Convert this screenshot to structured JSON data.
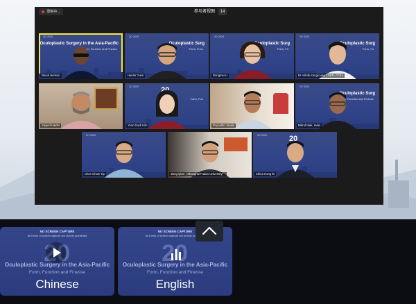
{
  "meeting": {
    "recording_label": "录制中...",
    "title": "参与者视图",
    "participant_count": "14"
  },
  "slide": {
    "header": "2O 2020",
    "title": "Oculoplastic Surgery in the Asia-Pacific",
    "subtitle": "Form, Function and Finesse"
  },
  "tiles": [
    {
      "name": "Raoul Henson",
      "kind": "slide-person",
      "active": true,
      "title": "Oculoplastic Surgery in the Asia-Pacific",
      "subtitle": "Form, Function and Finesse"
    },
    {
      "name": "Hunter Yuen",
      "kind": "slide-person",
      "title": "Oculoplastic Surg",
      "subtitle": "Form, Func"
    },
    {
      "name": "Dongmei Li",
      "kind": "slide-person",
      "title": "Oculoplastic Surg",
      "subtitle": "Form, Fu"
    },
    {
      "name": "Dr Ashok Kang-Lung CHEN, CCKL",
      "kind": "slide-person",
      "title": "Oculoplastic Surg",
      "subtitle": "Form, Fu"
    },
    {
      "name": "Saiyed Haider",
      "kind": "home-person"
    },
    {
      "name": "Yoon Duck Kim",
      "kind": "slide-person",
      "title": "20",
      "subtitle": "Form, Fun"
    },
    {
      "name": "Rcynaldo Javate",
      "kind": "home-person"
    },
    {
      "name": "Milind Naik, India",
      "kind": "slide-person",
      "title": "Oculoplastic Surg",
      "subtitle": "Form, Function and Finesse"
    },
    {
      "name": "Chen Chow Yip",
      "kind": "slide-person",
      "title": "",
      "subtitle": ""
    },
    {
      "name": "Jiong Qian（Shanghai Fudan University）",
      "kind": "home-person"
    },
    {
      "name": "China Hong lin",
      "kind": "slide-person",
      "title": "20",
      "subtitle": ""
    }
  ],
  "cards": [
    {
      "warning_title": "NO SCREEN CAPTURE",
      "warning_text": "All forms of screen capture are strictly prohibited",
      "title": "Oculoplastic Surgery in the Asia-Pacific",
      "subtitle": "Form, Function and Finesse",
      "language": "Chinese",
      "control_icon": "play-icon"
    },
    {
      "warning_title": "NO SCREEN CAPTURE",
      "warning_text": "All forms of screen capture are strictly prohibited",
      "title": "Oculoplastic Surgery in the Asia-Pacific",
      "subtitle": "Form, Function and Finesse",
      "language": "English",
      "control_icon": "bar-chart-icon"
    }
  ],
  "colors": {
    "slide_blue": "#32458a",
    "active_border": "#f2e64a",
    "bar_bg": "#0b0d12"
  }
}
